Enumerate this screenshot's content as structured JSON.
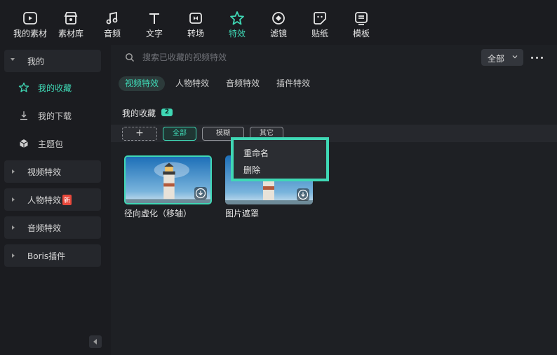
{
  "toolbar": {
    "items": [
      {
        "label": "我的素材",
        "icon": "media-icon"
      },
      {
        "label": "素材库",
        "icon": "store-icon"
      },
      {
        "label": "音频",
        "icon": "music-note-icon"
      },
      {
        "label": "文字",
        "icon": "text-icon"
      },
      {
        "label": "转场",
        "icon": "transition-icon"
      },
      {
        "label": "特效",
        "icon": "effects-star-icon",
        "active": true
      },
      {
        "label": "滤镜",
        "icon": "filter-icon"
      },
      {
        "label": "贴纸",
        "icon": "sticker-icon"
      },
      {
        "label": "模板",
        "icon": "template-icon"
      }
    ]
  },
  "sidebar": {
    "my": {
      "label": "我的"
    },
    "my_items": [
      {
        "label": "我的收藏",
        "icon": "star-icon",
        "active": true
      },
      {
        "label": "我的下载",
        "icon": "download-icon"
      },
      {
        "label": "主题包",
        "icon": "package-icon"
      }
    ],
    "groups": [
      {
        "label": "视频特效"
      },
      {
        "label": "人物特效",
        "badge": "新"
      },
      {
        "label": "音频特效"
      },
      {
        "label": "Boris插件"
      }
    ]
  },
  "search": {
    "placeholder": "搜索已收藏的视频特效",
    "filter_value": "全部"
  },
  "tabs": [
    {
      "label": "视频特效",
      "active": true
    },
    {
      "label": "人物特效"
    },
    {
      "label": "音频特效"
    },
    {
      "label": "插件特效"
    }
  ],
  "section": {
    "title": "我的收藏",
    "count": "2"
  },
  "chips": [
    {
      "label": "+"
    },
    {
      "label": "全部",
      "active": true
    },
    {
      "label": "模糊"
    },
    {
      "label": "其它"
    }
  ],
  "cards": [
    {
      "label": "径向虚化（移轴）",
      "selected": true
    },
    {
      "label": "图片遮罩"
    }
  ],
  "context_menu": {
    "items": [
      "重命名",
      "删除"
    ]
  },
  "colors": {
    "accent": "#3fd8b5",
    "background": "#1e2024",
    "badge_new": "#e8483b"
  }
}
